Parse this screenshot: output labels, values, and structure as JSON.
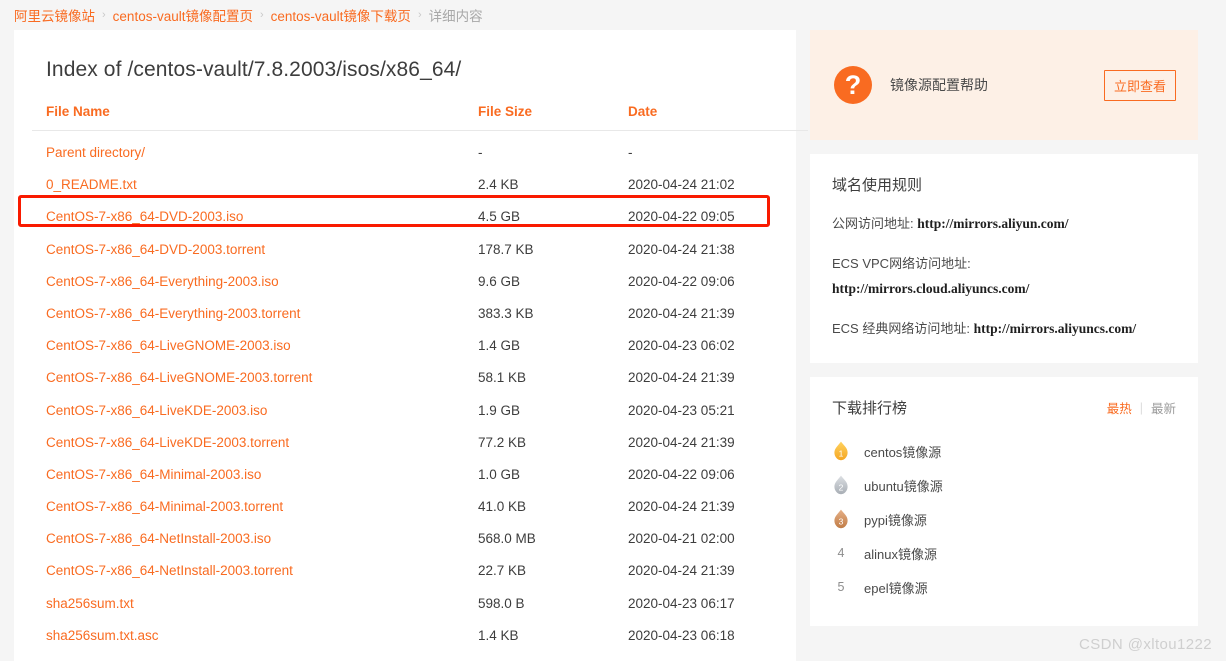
{
  "breadcrumb": {
    "separator": "›",
    "items": [
      {
        "label": "阿里云镜像站",
        "current": false
      },
      {
        "label": "centos-vault镜像配置页",
        "current": false
      },
      {
        "label": "centos-vault镜像下载页",
        "current": false
      },
      {
        "label": "详细内容",
        "current": true
      }
    ]
  },
  "index": {
    "title": "Index of /centos-vault/7.8.2003/isos/x86_64/",
    "columns": {
      "name": "File Name",
      "size": "File Size",
      "date": "Date"
    },
    "rows": [
      {
        "name": "Parent directory/",
        "size": "-",
        "date": "-",
        "highlight": false
      },
      {
        "name": "0_README.txt",
        "size": "2.4 KB",
        "date": "2020-04-24 21:02",
        "highlight": false
      },
      {
        "name": "CentOS-7-x86_64-DVD-2003.iso",
        "size": "4.5 GB",
        "date": "2020-04-22 09:05",
        "highlight": true
      },
      {
        "name": "CentOS-7-x86_64-DVD-2003.torrent",
        "size": "178.7 KB",
        "date": "2020-04-24 21:38",
        "highlight": false
      },
      {
        "name": "CentOS-7-x86_64-Everything-2003.iso",
        "size": "9.6 GB",
        "date": "2020-04-22 09:06",
        "highlight": false
      },
      {
        "name": "CentOS-7-x86_64-Everything-2003.torrent",
        "size": "383.3 KB",
        "date": "2020-04-24 21:39",
        "highlight": false
      },
      {
        "name": "CentOS-7-x86_64-LiveGNOME-2003.iso",
        "size": "1.4 GB",
        "date": "2020-04-23 06:02",
        "highlight": false
      },
      {
        "name": "CentOS-7-x86_64-LiveGNOME-2003.torrent",
        "size": "58.1 KB",
        "date": "2020-04-24 21:39",
        "highlight": false
      },
      {
        "name": "CentOS-7-x86_64-LiveKDE-2003.iso",
        "size": "1.9 GB",
        "date": "2020-04-23 05:21",
        "highlight": false
      },
      {
        "name": "CentOS-7-x86_64-LiveKDE-2003.torrent",
        "size": "77.2 KB",
        "date": "2020-04-24 21:39",
        "highlight": false
      },
      {
        "name": "CentOS-7-x86_64-Minimal-2003.iso",
        "size": "1.0 GB",
        "date": "2020-04-22 09:06",
        "highlight": false
      },
      {
        "name": "CentOS-7-x86_64-Minimal-2003.torrent",
        "size": "41.0 KB",
        "date": "2020-04-24 21:39",
        "highlight": false
      },
      {
        "name": "CentOS-7-x86_64-NetInstall-2003.iso",
        "size": "568.0 MB",
        "date": "2020-04-21 02:00",
        "highlight": false
      },
      {
        "name": "CentOS-7-x86_64-NetInstall-2003.torrent",
        "size": "22.7 KB",
        "date": "2020-04-24 21:39",
        "highlight": false
      },
      {
        "name": "sha256sum.txt",
        "size": "598.0 B",
        "date": "2020-04-23 06:17",
        "highlight": false
      },
      {
        "name": "sha256sum.txt.asc",
        "size": "1.4 KB",
        "date": "2020-04-23 06:18",
        "highlight": false
      }
    ]
  },
  "help_banner": {
    "icon": "question-mark",
    "text": "镜像源配置帮助",
    "button_label": "立即查看"
  },
  "domain_rules": {
    "title": "域名使用规则",
    "lines": [
      {
        "label": "公网访问地址:",
        "url": "http://mirrors.aliyun.com/",
        "url_on_new_line": false
      },
      {
        "label": "ECS VPC网络访问地址:",
        "url": "http://mirrors.cloud.aliyuncs.com/",
        "url_on_new_line": true
      },
      {
        "label": "ECS 经典网络访问地址:",
        "url": "http://mirrors.aliyuncs.com/",
        "url_on_new_line": false
      }
    ]
  },
  "ranking": {
    "title": "下载排行榜",
    "tabs": [
      {
        "label": "最热",
        "active": true
      },
      {
        "label": "最新",
        "active": false
      }
    ],
    "tab_separator": "|",
    "items": [
      {
        "rank": "1",
        "label": "centos镜像源",
        "badge": "gold"
      },
      {
        "rank": "2",
        "label": "ubuntu镜像源",
        "badge": "silver"
      },
      {
        "rank": "3",
        "label": "pypi镜像源",
        "badge": "bronze"
      },
      {
        "rank": "4",
        "label": "alinux镜像源",
        "badge": "none"
      },
      {
        "rank": "5",
        "label": "epel镜像源",
        "badge": "none"
      }
    ]
  },
  "watermark": "CSDN @xltou1222",
  "colors": {
    "accent": "#f96b21",
    "highlight_box": "#f91a00",
    "page_bg": "#f5f5f5",
    "help_bg": "#fdf0e6"
  }
}
